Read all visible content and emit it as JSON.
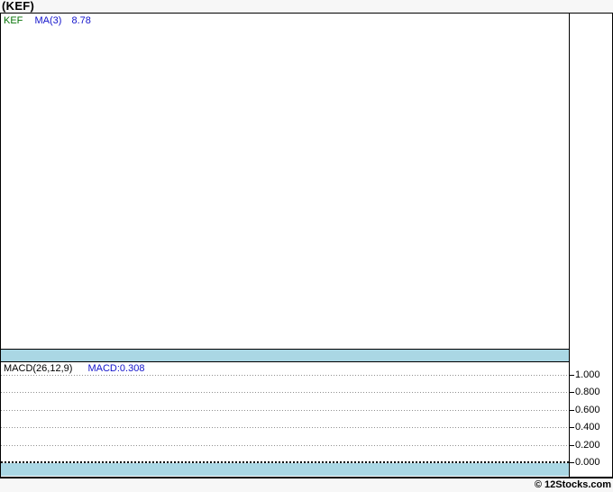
{
  "page": {
    "title": "(KEF)",
    "credit": "© 12Stocks.com"
  },
  "colors": {
    "page_background": "#f7f7f7",
    "panel_background": "#ffffff",
    "border": "#000000",
    "separator_band": "#aad7e4",
    "symbol_green": "#077307",
    "indicator_blue": "#1313cb",
    "gridline_gray": "#909090"
  },
  "price_panel": {
    "legend": {
      "symbol": "KEF",
      "ma_label": "MA(3)",
      "ma_value": "8.78"
    }
  },
  "macd_panel": {
    "indicator_label": "MACD(26,12,9)",
    "indicator_value": "MACD:0.308",
    "axis_ticks": [
      "1.000",
      "0.800",
      "0.600",
      "0.400",
      "0.200",
      "0.000"
    ]
  },
  "chart_data": [
    {
      "type": "line",
      "title": "(KEF) price panel",
      "series": [
        {
          "name": "KEF",
          "values": []
        },
        {
          "name": "MA(3)",
          "values": [],
          "latest_value": 8.78
        }
      ],
      "annotations": [
        "KEF",
        "MA(3)",
        "8.78"
      ],
      "grid": false,
      "legend_position": "top-left",
      "note": "plot area is blank in the screenshot; no price series pixels are drawn"
    },
    {
      "type": "line",
      "title": "MACD(26,12,9)",
      "series": [
        {
          "name": "MACD",
          "values": [],
          "latest_value": 0.308
        }
      ],
      "ytick_labels": [
        "1.000",
        "0.800",
        "0.600",
        "0.400",
        "0.200",
        "0.000"
      ],
      "ytick_values": [
        1.0,
        0.8,
        0.6,
        0.4,
        0.2,
        0.0
      ],
      "ylim": [
        -0.18,
        1.15
      ],
      "grid": true,
      "zero_line": true,
      "legend_position": "top-left",
      "note": "only dotted gridlines and the bold dotted zero line are visible; no MACD curve pixels are drawn"
    }
  ]
}
